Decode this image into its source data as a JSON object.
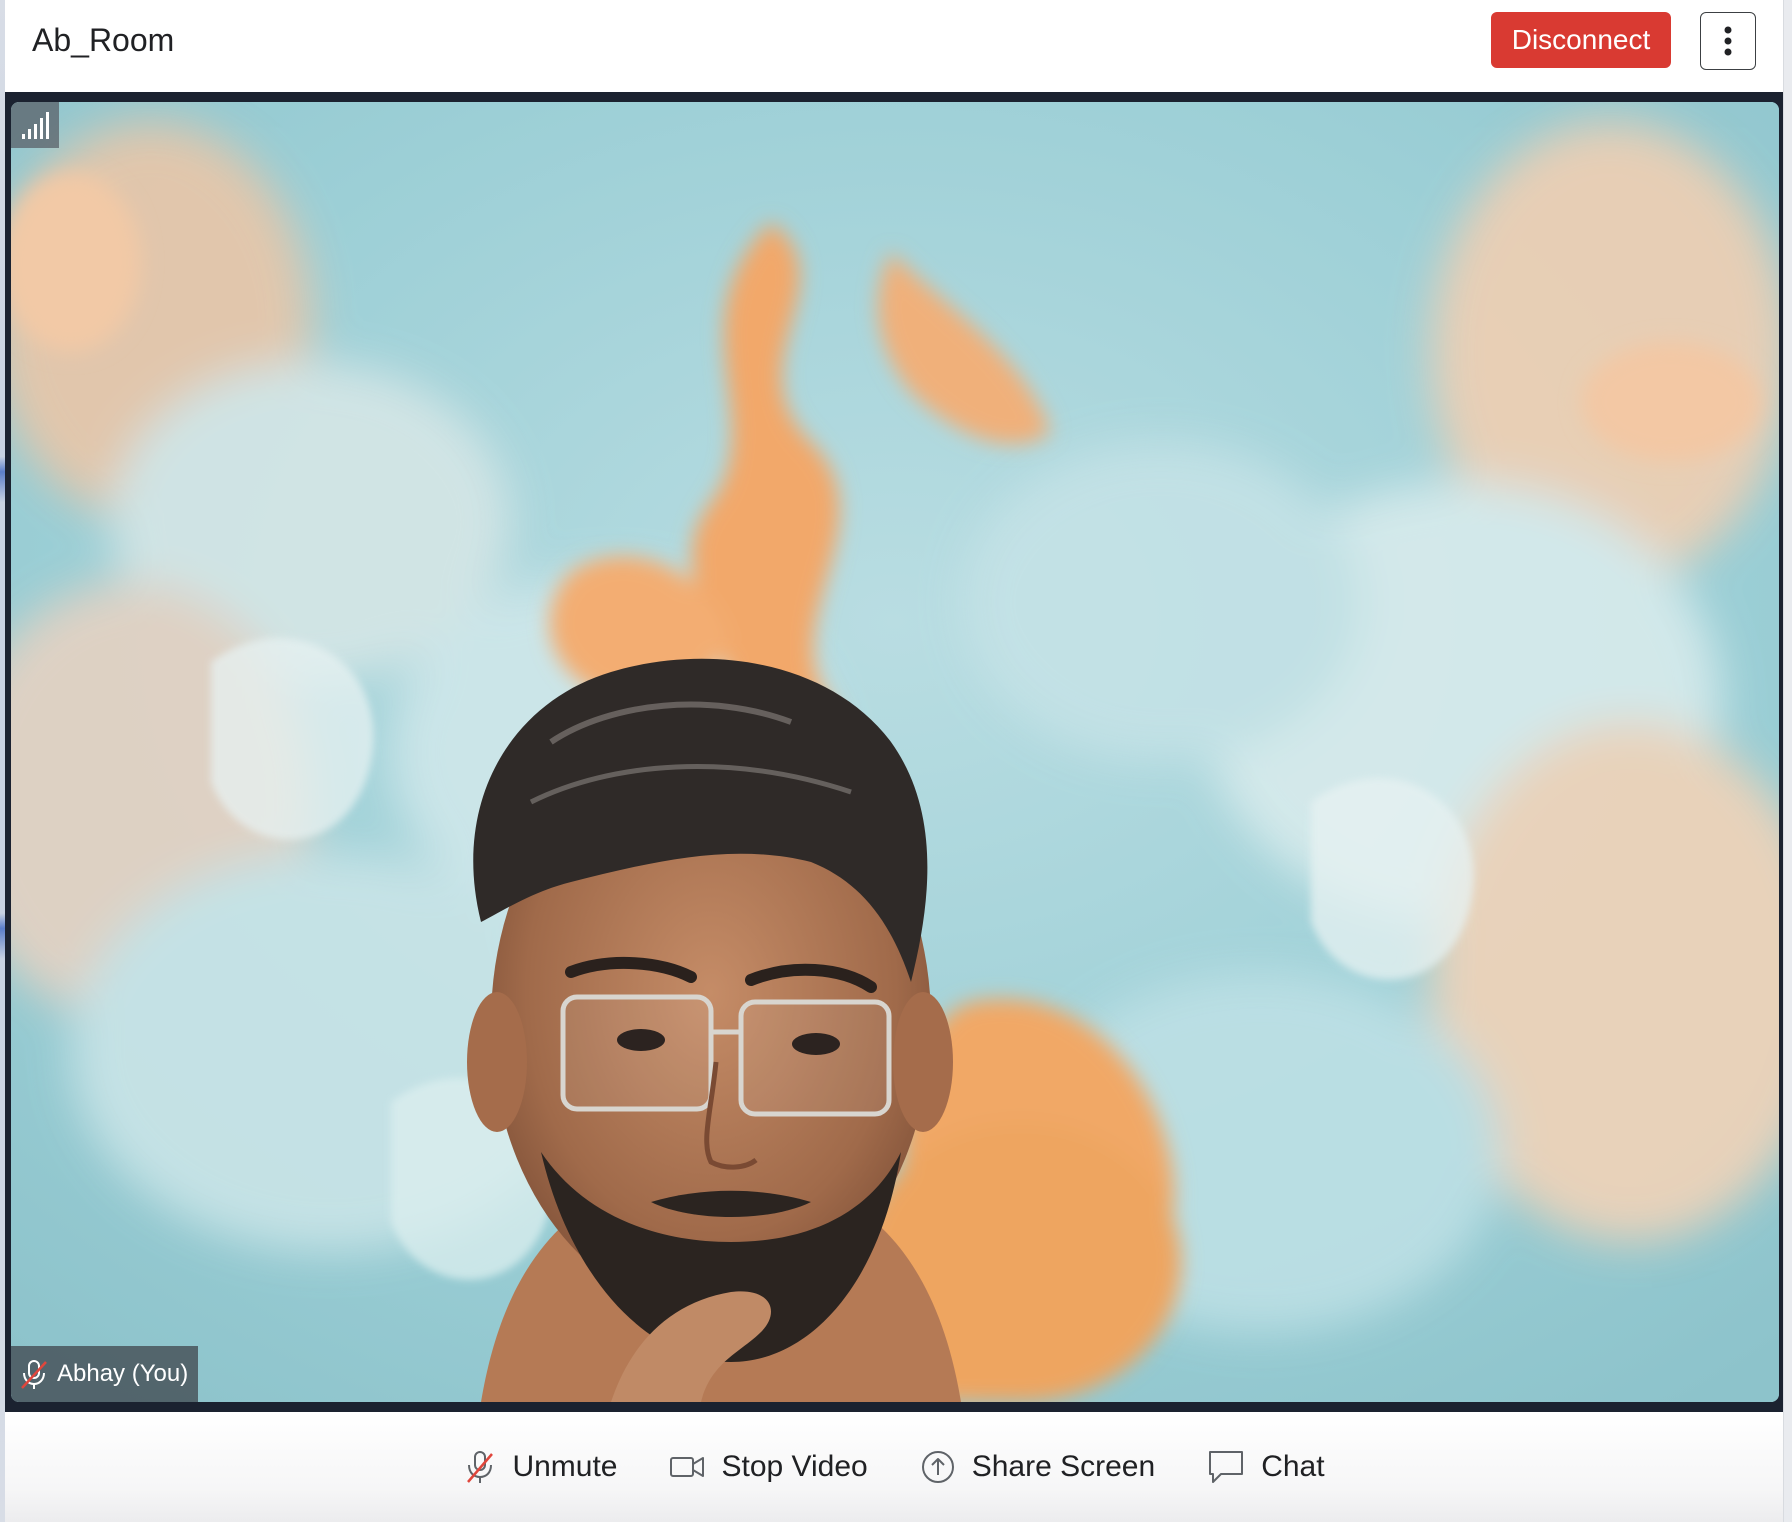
{
  "header": {
    "room_title": "Ab_Room",
    "disconnect_label": "Disconnect",
    "more_icon": "vertical-dots-icon"
  },
  "video": {
    "participant_name": "Abhay (You)",
    "signal_icon": "signal-strength-icon",
    "mic_muted_icon": "mic-off-icon"
  },
  "toolbar": {
    "unmute_label": "Unmute",
    "stop_video_label": "Stop Video",
    "share_screen_label": "Share Screen",
    "chat_label": "Chat"
  },
  "colors": {
    "disconnect": "#d93a32",
    "video_border": "#1b2230",
    "background_teal": "#a9d2d8",
    "background_orange": "#f0a96a"
  }
}
